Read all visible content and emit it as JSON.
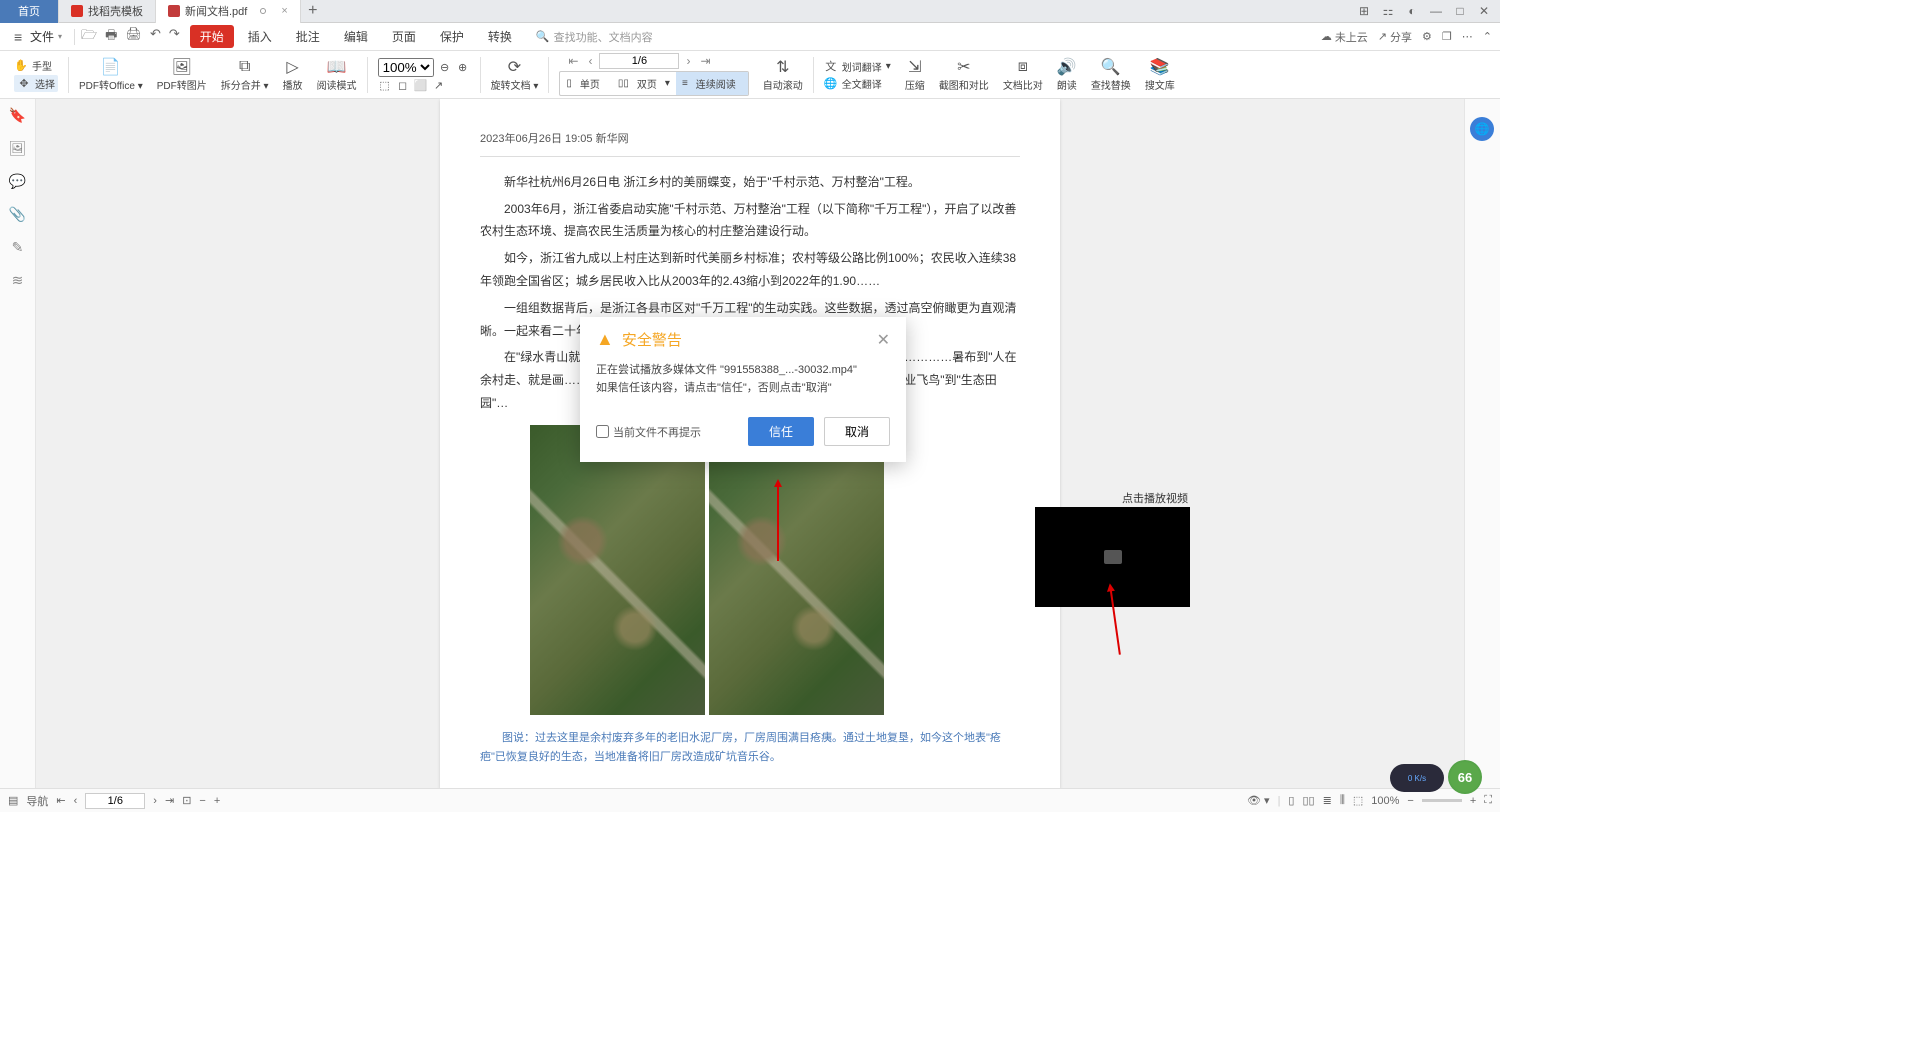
{
  "tabs": {
    "home": "首页",
    "template": "找稻壳模板",
    "active": "新闻文档.pdf"
  },
  "menu": {
    "file": "文件",
    "items": [
      "开始",
      "插入",
      "批注",
      "编辑",
      "页面",
      "保护",
      "转换"
    ],
    "active_index": 0,
    "search_placeholder": "查找功能、文档内容",
    "right": {
      "cloud": "未上云",
      "share": "分享"
    }
  },
  "ribbon": {
    "hand": "手型",
    "select": "选择",
    "to_office": "PDF转Office",
    "to_image": "PDF转图片",
    "split": "拆分合并",
    "play": "播放",
    "read_mode": "阅读模式",
    "zoom": "100%",
    "rotate": "旋转文档",
    "page_current": "1/6",
    "single": "单页",
    "double": "双页",
    "continuous": "连续阅读",
    "auto_scroll": "自动滚动",
    "word_trans": "划词翻译",
    "full_trans": "全文翻译",
    "compress": "压缩",
    "crop_compare": "截图和对比",
    "doc_compare": "文档比对",
    "read_aloud": "朗读",
    "find_replace": "查找替换",
    "souwenku": "搜文库"
  },
  "document": {
    "meta": "2023年06月26日 19:05   新华网",
    "p1": "新华社杭州6月26日电   浙江乡村的美丽蝶变，始于\"千村示范、万村整治\"工程。",
    "p2": "2003年6月，浙江省委启动实施\"千村示范、万村整治\"工程（以下简称\"千万工程\"），开启了以改善农村生态环境、提高农民生活质量为核心的村庄整治建设行动。",
    "p3": "如今，浙江省九成以上村庄达到新时代美丽乡村标准；农村等级公路比例100%；农民收入连续38年领跑全国省区；城乡居民收入比从2003年的2.43缩小到2022年的1.90……",
    "p4": "一组组数据背后，是浙江各县市区对\"千万工程\"的生动实践。这些数据，透过高空俯瞰更为直观清晰。一起来看二十年来，卫星记录下的浙江山乡巨变。",
    "p5": "在\"绿水青山就是………………………………………………………………………………暑布到\"人在余村走、就是画………………………………………………………………………\"工业飞鸟\"到\"生态田园\"…",
    "video_label": "点击播放视频",
    "caption": "图说：过去这里是余村废弃多年的老旧水泥厂房，厂房周围满目疮痍。通过土地复垦，如今这个地表\"疮疤\"已恢复良好的生态，当地准备将旧厂房改造成矿坑音乐谷。"
  },
  "dialog": {
    "title": "安全警告",
    "line1": "正在尝试播放多媒体文件 \"991558388_...-30032.mp4\"",
    "line2": "如果信任该内容，请点击\"信任\"，否则点击\"取消\"",
    "no_prompt": "当前文件不再提示",
    "trust": "信任",
    "cancel": "取消"
  },
  "status": {
    "nav": "导航",
    "page": "1/6",
    "zoom": "100%"
  },
  "badge": "66",
  "net": "0 K/s"
}
